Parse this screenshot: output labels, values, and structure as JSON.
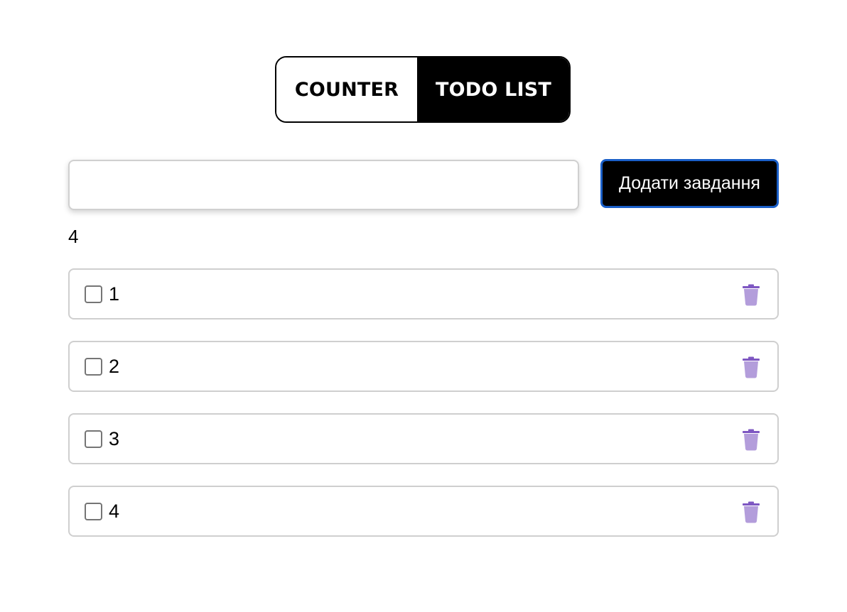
{
  "tabs": {
    "counter_label": "COUNTER",
    "todo_label": "TODO LIST",
    "active": "TODO LIST"
  },
  "form": {
    "input_value": "",
    "input_placeholder": "",
    "add_button_label": "Додати завдання"
  },
  "count": "4",
  "todos": [
    {
      "text": "1",
      "checked": false
    },
    {
      "text": "2",
      "checked": false
    },
    {
      "text": "3",
      "checked": false
    },
    {
      "text": "4",
      "checked": false
    }
  ],
  "colors": {
    "accent": "#000000",
    "button_border": "#1a5fc8",
    "trash_icon": "#b39ddb",
    "trash_icon_lid": "#7e57c2",
    "item_border": "#cfcfcf"
  },
  "icons": {
    "delete": "trash-icon"
  }
}
